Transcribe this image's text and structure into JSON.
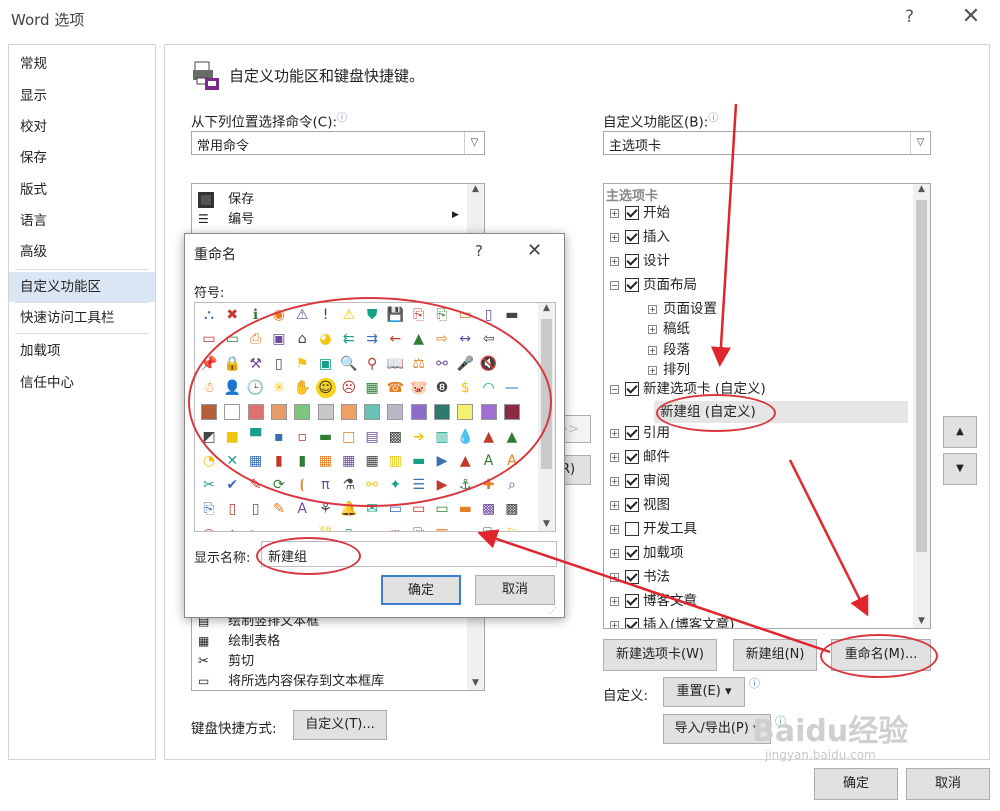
{
  "window": {
    "title": "Word 选项",
    "help": "?",
    "close": "✕"
  },
  "sidebar": {
    "items": [
      {
        "label": "常规"
      },
      {
        "label": "显示"
      },
      {
        "label": "校对"
      },
      {
        "label": "保存"
      },
      {
        "label": "版式"
      },
      {
        "label": "语言"
      },
      {
        "label": "高级"
      },
      {
        "label": "自定义功能区",
        "selected": true
      },
      {
        "label": "快速访问工具栏"
      },
      {
        "label": "加载项"
      },
      {
        "label": "信任中心"
      }
    ]
  },
  "main": {
    "heading": "自定义功能区和键盘快捷键。",
    "left_label": "从下列位置选择命令(C):",
    "left_combo": "常用命令",
    "left_list": [
      {
        "icon": "save-icon",
        "label": "保存"
      },
      {
        "icon": "numbering-icon",
        "label": "编号"
      },
      {
        "icon": "draw-textbox-icon",
        "label": "绘制竖排文本框"
      },
      {
        "icon": "draw-table-icon",
        "label": "绘制表格"
      },
      {
        "icon": "cut-icon",
        "label": "剪切"
      },
      {
        "icon": "save-selection-icon",
        "label": "将所选内容保存到文本框库"
      }
    ],
    "right_label": "自定义功能区(B):",
    "right_combo": "主选项卡",
    "tree_header": "主选项卡",
    "tree": [
      {
        "label": "开始",
        "checked": true,
        "level": 0,
        "exp": "+"
      },
      {
        "label": "插入",
        "checked": true,
        "level": 0,
        "exp": "+"
      },
      {
        "label": "设计",
        "checked": true,
        "level": 0,
        "exp": "+"
      },
      {
        "label": "页面布局",
        "checked": true,
        "level": 0,
        "exp": "−"
      },
      {
        "label": "页面设置",
        "level": 1,
        "exp": "+"
      },
      {
        "label": "稿纸",
        "level": 1,
        "exp": "+"
      },
      {
        "label": "段落",
        "level": 1,
        "exp": "+"
      },
      {
        "label": "排列",
        "level": 1,
        "exp": "+"
      },
      {
        "label": "新建选项卡 (自定义)",
        "checked": true,
        "level": 0,
        "exp": "−"
      },
      {
        "label": "新建组 (自定义)",
        "level": 2,
        "selected": true
      },
      {
        "label": "引用",
        "checked": true,
        "level": 0,
        "exp": "+"
      },
      {
        "label": "邮件",
        "checked": true,
        "level": 0,
        "exp": "+"
      },
      {
        "label": "审阅",
        "checked": true,
        "level": 0,
        "exp": "+"
      },
      {
        "label": "视图",
        "checked": true,
        "level": 0,
        "exp": "+"
      },
      {
        "label": "开发工具",
        "checked": false,
        "level": 0,
        "exp": "+"
      },
      {
        "label": "加载项",
        "checked": true,
        "level": 0,
        "exp": "+"
      },
      {
        "label": "书法",
        "checked": true,
        "level": 0,
        "exp": "+"
      },
      {
        "label": "博客文章",
        "checked": true,
        "level": 0,
        "exp": "+"
      },
      {
        "label": "插入(博客文章)",
        "checked": true,
        "level": 0,
        "exp": "+"
      }
    ],
    "buttons": {
      "new_tab": "新建选项卡(W)",
      "new_group": "新建组(N)",
      "rename": "重命名(M)...",
      "customize_label": "自定义:",
      "reset": "重置(E) ▾",
      "import_export": "导入/导出(P) ▾",
      "keyboard_label": "键盘快捷方式:",
      "keyboard_btn": "自定义(T)...",
      "ok": "确定",
      "cancel": "取消",
      "add_partial": ">>",
      "remove_partial": "R)"
    }
  },
  "dialog": {
    "title": "重命名",
    "help": "?",
    "close": "✕",
    "symbol_label": "符号:",
    "display_name_label": "显示名称:",
    "display_name_value": "新建组",
    "ok": "确定",
    "cancel": "取消",
    "symbol_rows": [
      [
        "⛬",
        "✖",
        "ℹ",
        "◉",
        "⚠",
        "!",
        "⚠",
        "⛊",
        "💾",
        "⎘",
        "⎘",
        "▭",
        "▯",
        "▬"
      ],
      [
        "▭",
        "▭",
        "⎙",
        "▣",
        "⌂",
        "◕",
        "⇇",
        "⇉",
        "←",
        "▲",
        "⇨",
        "↔",
        "⇦",
        ""
      ],
      [
        "📌",
        "🔒",
        "⚒",
        "▯",
        "⚑",
        "▣",
        "🔍",
        "⚲",
        "📖",
        "⚖",
        "⚯",
        "🎤",
        "🔇",
        ""
      ],
      [
        "☃",
        "👤",
        "🕒",
        "✳",
        "✋",
        "☺",
        "☹",
        "▦",
        "☎",
        "🐷",
        "❽",
        "$",
        "◠",
        "—"
      ]
    ],
    "swatch_row": [
      "#b5603a",
      "#ffffff",
      "#e07070",
      "#e59b6a",
      "#7ec67e",
      "#c8c8c8",
      "#f0a060",
      "#6cc2b8",
      "#b8b8c8",
      "#8c6cc8",
      "#2e7a6a",
      "#f4f070",
      "#a070d0",
      "#8a2a44"
    ],
    "symbol_rows_2": [
      [
        "◩",
        "■",
        "▀",
        "▪",
        "▫",
        "▬",
        "□",
        "▤",
        "▩",
        "➔",
        "▥",
        "💧",
        "▲",
        "▲"
      ],
      [
        "◔",
        "✕",
        "▦",
        "▮",
        "▮",
        "▦",
        "▦",
        "▦",
        "▥",
        "▬",
        "▶",
        "▲",
        "A",
        "A"
      ],
      [
        "✂",
        "✔",
        "✎",
        "⟳",
        "⦗",
        "π",
        "⚗",
        "⚯",
        "✦",
        "☰",
        "▶",
        "⚓",
        "✚",
        "⌕"
      ],
      [
        "⎘",
        "▯",
        "▯",
        "✎",
        "A",
        "⚘",
        "🔔",
        "✉",
        "▭",
        "▭",
        "▭",
        "▬",
        "▩",
        "▩"
      ],
      [
        "◉",
        "⌂",
        "✂",
        "—",
        "▭",
        "⛓",
        "▯",
        "▭",
        "⚮",
        "⎘",
        "▦",
        "▭",
        "⎘",
        "⚐"
      ]
    ]
  },
  "watermark": {
    "brand": "Baidu经验",
    "url": "jingyan.baidu.com"
  }
}
